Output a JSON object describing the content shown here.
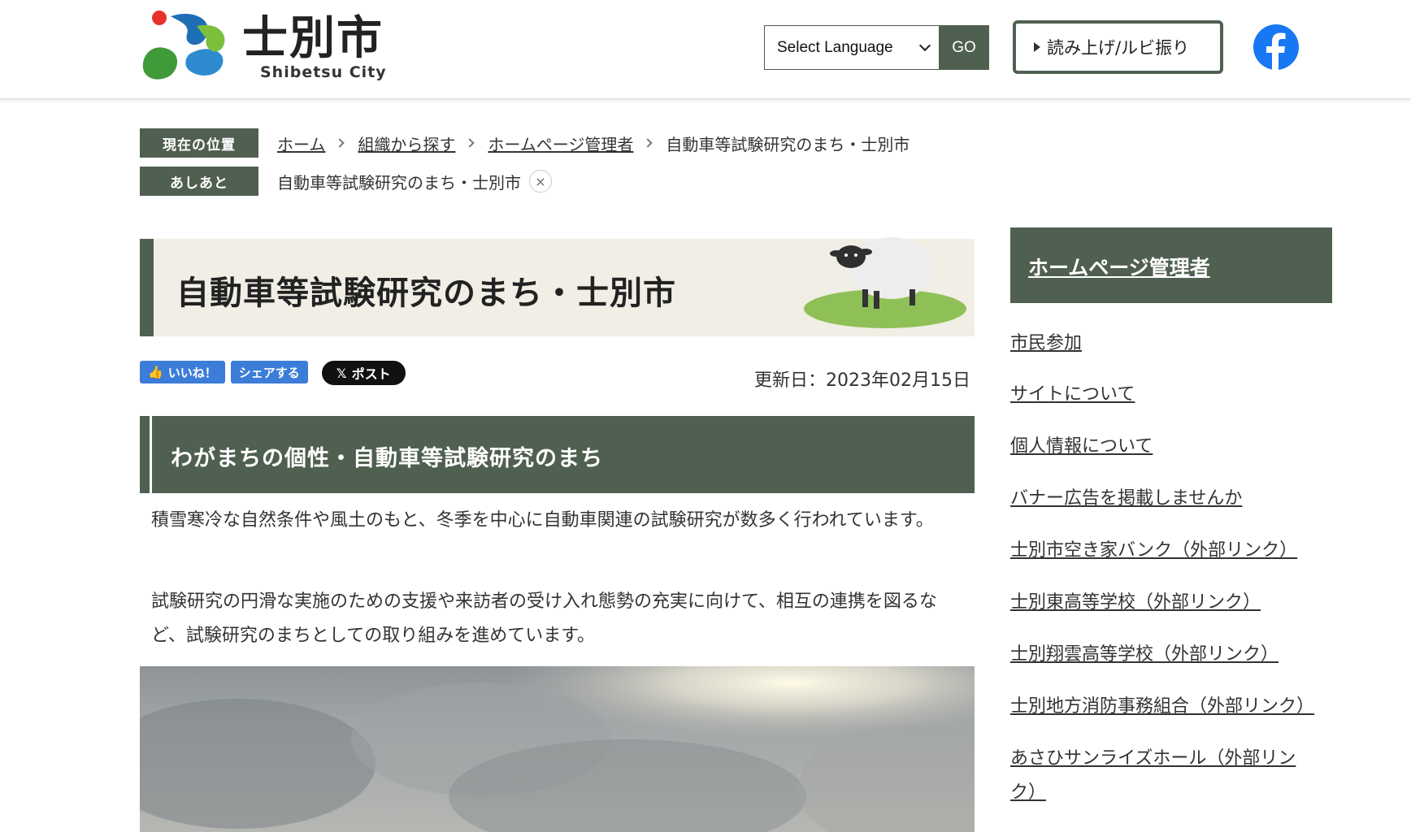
{
  "header": {
    "logo_title": "士別市",
    "logo_sub": "Shibetsu City",
    "language_select": "Select Language",
    "go_button": "GO",
    "read_button": "読み上げ/ルビ振り",
    "facebook_icon": "facebook-icon"
  },
  "breadcrumb": {
    "current_label": "現在の位置",
    "items": [
      "ホーム",
      "組織から探す",
      "ホームページ管理者",
      "自動車等試験研究のまち・士別市"
    ],
    "history_label": "あしあと",
    "history_item": "自動車等試験研究のまち・士別市",
    "close_glyph": "×"
  },
  "page": {
    "title": "自動車等試験研究のまち・士別市",
    "social": {
      "like": "いいね！",
      "share": "シェアする",
      "post": "ポスト"
    },
    "updated": "更新日：2023年02月15日",
    "section_heading": "わがまちの個性・自動車等試験研究のまち",
    "paragraphs": [
      "積雪寒冷な自然条件や風土のもと、冬季を中心に自動車関連の試験研究が数多く行われています。",
      "試験研究の円滑な実施のための支援や来訪者の受け入れ態勢の充実に向けて、相互の連携を図るなど、試験研究のまちとしての取り組みを進めています。"
    ]
  },
  "sidebar": {
    "heading": "ホームページ管理者",
    "links": [
      "市民参加",
      "サイトについて",
      "個人情報について",
      "バナー広告を掲載しませんか",
      "士別市空き家バンク（外部リンク）",
      "士別東高等学校（外部リンク）",
      "士別翔雲高等学校（外部リンク）",
      "士別地方消防事務組合（外部リンク）",
      "あさひサンライズホール（外部リンク）"
    ]
  },
  "colors": {
    "accent": "#506050",
    "banner_bg": "#f1eee5",
    "social_blue": "#3b7dd8"
  }
}
